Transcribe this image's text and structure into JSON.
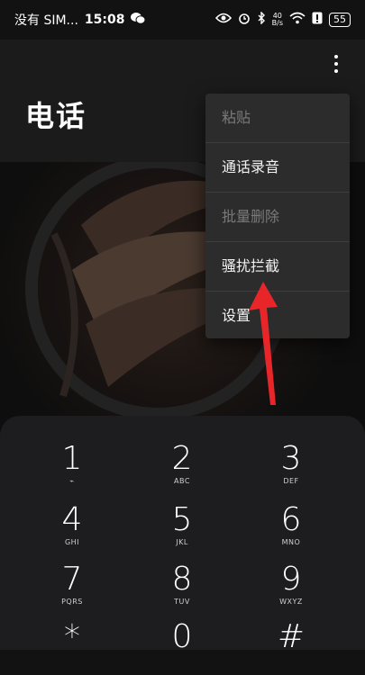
{
  "status_bar": {
    "carrier": "没有 SIM...",
    "time": "15:08",
    "net_speed_top": "40",
    "net_speed_bottom": "B/s",
    "battery": "55"
  },
  "header": {
    "title": "电话"
  },
  "menu": {
    "items": [
      {
        "label": "粘贴",
        "enabled": false
      },
      {
        "label": "通话录音",
        "enabled": true
      },
      {
        "label": "批量删除",
        "enabled": false
      },
      {
        "label": "骚扰拦截",
        "enabled": true
      },
      {
        "label": "设置",
        "enabled": true
      }
    ]
  },
  "dialpad": {
    "keys": [
      {
        "num": "1",
        "letters": "⌁"
      },
      {
        "num": "2",
        "letters": "ABC"
      },
      {
        "num": "3",
        "letters": "DEF"
      },
      {
        "num": "4",
        "letters": "GHI"
      },
      {
        "num": "5",
        "letters": "JKL"
      },
      {
        "num": "6",
        "letters": "MNO"
      },
      {
        "num": "7",
        "letters": "PQRS"
      },
      {
        "num": "8",
        "letters": "TUV"
      },
      {
        "num": "9",
        "letters": "WXYZ"
      },
      {
        "num": "*",
        "letters": ""
      },
      {
        "num": "0",
        "letters": ""
      },
      {
        "num": "#",
        "letters": ""
      }
    ]
  },
  "colors": {
    "annotation_arrow": "#e8262a",
    "menu_bg": "#2c2c2c",
    "dialpad_bg": "#1d1d1f"
  }
}
